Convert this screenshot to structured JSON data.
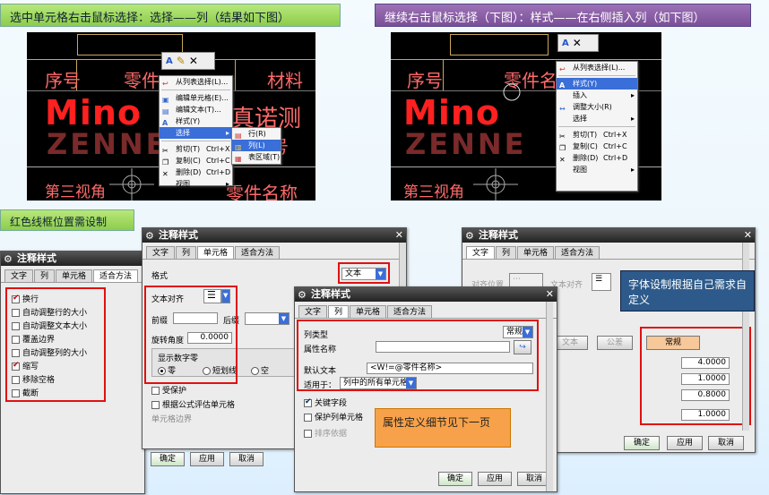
{
  "banners": {
    "top_left": "选中单元格右击鼠标选择：选择——列（结果如下图）",
    "top_right": "继续右击鼠标选择（下图）：样式——在右侧插入列（如下图）",
    "mid_left": "红色线框位置需设制"
  },
  "cad_left": {
    "seq": "序号",
    "part": "零件",
    "material": "材料",
    "mino": "Mino",
    "zenne": "ZENNE",
    "zhen": "真诺测",
    "bianhao": "编号",
    "view": "第三视角",
    "partname": "零件名称"
  },
  "cad_right": {
    "seq": "序号",
    "part": "零件名",
    "mino": "Mino",
    "zenne": "ZENNE",
    "view": "第三视角"
  },
  "menu_left": {
    "items": [
      {
        "label": "从列表选择(L)..."
      },
      {
        "label": "编辑单元格(E)..."
      },
      {
        "label": "编辑文本(T)..."
      },
      {
        "label": "样式(Y)"
      },
      {
        "label": "选择"
      },
      {
        "label": "剪切(T)",
        "shortcut": "Ctrl+X"
      },
      {
        "label": "复制(C)",
        "shortcut": "Ctrl+C"
      },
      {
        "label": "删除(D)",
        "shortcut": "Ctrl+D"
      },
      {
        "label": "视图"
      }
    ],
    "submenu": [
      {
        "label": "行(R)"
      },
      {
        "label": "列(L)"
      },
      {
        "label": "表区域(T)"
      }
    ]
  },
  "menu_right": {
    "items": [
      {
        "label": "从列表选择(L)..."
      },
      {
        "label": "样式(Y)"
      },
      {
        "label": "插入"
      },
      {
        "label": "调整大小(R)"
      },
      {
        "label": "选择"
      },
      {
        "label": "剪切(T)",
        "shortcut": "Ctrl+X"
      },
      {
        "label": "复制(C)",
        "shortcut": "Ctrl+C"
      },
      {
        "label": "删除(D)",
        "shortcut": "Ctrl+D"
      },
      {
        "label": "视图"
      }
    ]
  },
  "dlg1": {
    "title": "注释样式",
    "tabs": [
      "文字",
      "列",
      "单元格",
      "适合方法"
    ],
    "checks": [
      {
        "label": "换行",
        "on": true
      },
      {
        "label": "自动调整行的大小",
        "on": false
      },
      {
        "label": "自动调整文本大小",
        "on": false
      },
      {
        "label": "覆盖边界",
        "on": false
      },
      {
        "label": "自动调整列的大小",
        "on": false
      },
      {
        "label": "缩写",
        "on": true
      },
      {
        "label": "移除空格",
        "on": false
      },
      {
        "label": "截断",
        "on": false
      }
    ],
    "ok": "确定",
    "apply": "应用",
    "cancel": "取消"
  },
  "dlg2": {
    "title": "注释样式",
    "tabs": [
      "文字",
      "列",
      "单元格",
      "适合方法"
    ],
    "format_label": "格式",
    "format_value": "文本",
    "align_label": "文本对齐",
    "prefix_label": "前缀",
    "suffix_label": "后缀",
    "angle_label": "旋转角度",
    "angle_value": "0.0000",
    "zero_label": "显示数字零",
    "zero_opts": [
      "零",
      "短划线",
      "空"
    ],
    "protect": "受保护",
    "formula": "根据公式评估单元格",
    "border": "单元格边界"
  },
  "dlg3": {
    "title": "注释样式",
    "tabs": [
      "文字",
      "列",
      "单元格",
      "适合方法"
    ],
    "col_type_label": "列类型",
    "col_type_value": "常规",
    "attr_label": "属性名称",
    "default_label": "默认文本",
    "default_value": "<W!=@零件名称>",
    "apply_label": "适用于：",
    "apply_value": "列中的所有单元格",
    "key_field": "关键字段",
    "protect_col": "保护列单元格",
    "sort": "排序依据",
    "ok": "确定",
    "apply": "应用",
    "cancel": "取消"
  },
  "dlg4": {
    "title": "注释样式",
    "tabs": [
      "文字",
      "列",
      "单元格",
      "适合方法"
    ],
    "align_pos": "对齐位置",
    "text_align": "文本对齐",
    "text_btn": "文本",
    "common_btn": "公差",
    "normal_btn": "常规",
    "values": [
      "4.0000",
      "1.0000",
      "0.8000",
      "1.0000"
    ],
    "ok": "确定",
    "apply": "应用",
    "cancel": "取消"
  },
  "callouts": {
    "font": "字体设制根据自己需求自定义",
    "attr": "属性定义细节见下一页"
  }
}
